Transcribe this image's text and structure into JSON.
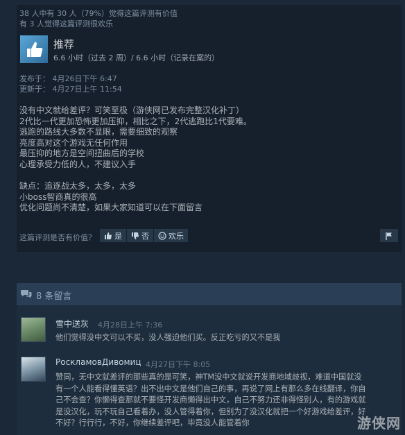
{
  "review": {
    "helpful_line1": "38 人中有 30 人（79%）觉得这篇评测有价值",
    "helpful_line2": "有 3 人觉得这篇评测很欢乐",
    "recommend_label": "推荐",
    "hours": "6.6 小时（过去 2 周）/ 6.6 小时（记录在案的）",
    "posted": "发布于：  4月26日下午 6:47",
    "updated": "更新于：  4月27日上午 11:54",
    "body": [
      "没有中文就给差评？可笑至极（游侠网已发布完整汉化补丁）",
      "2代比一代更加恐怖更加压抑，相比之下，2代逃跑比1代要难。",
      "逃跑的路线大多数不显眼，需要细致的观察",
      "亮度高对这个游戏无任何作用",
      "最压抑的地方是空间扭曲后的学校",
      "心理承受力低的人，不建议入手",
      "",
      "缺点：追逐战太多，太多，太多",
      "小boss智商真的很高",
      "优化问题尚不清楚，如果大家知道可以在下面留言"
    ],
    "helpful_question": "这篇评测是否有价值？",
    "vote_yes": "是",
    "vote_no": "否",
    "vote_funny": "欢乐"
  },
  "comments_header": {
    "label": "8 条留言"
  },
  "comments": [
    {
      "author": "雪中送灰",
      "date": "4月28日上午 7:36",
      "lines": [
        "他们觉得没中文可以不买，没人强迫他们买。反正吃亏的又不是我"
      ]
    },
    {
      "author": "РоскламовДивомиц",
      "date": "4月27日下午 8:05",
      "lines": [
        "赞同，无中文就差评的那些真的是可笑，神TM没中文就说开发商地域歧视，难道中国就没",
        "有一个人能看得懂英语？出不出中文是他们自己的事，再说了网上有那么多在线翻译，你自",
        "己不会查？你懒得查那就不要怪开发商懒得出中文，自己不努力还非得怪别人，有的游戏就",
        "是没汉化，玩不玩自己看着办，没人管得着你，但别为了没汉化就把一个好游戏给差评，好",
        "不好？行行行，不好，你继续差评吧，毕竟没人能管着你"
      ]
    }
  ],
  "watermark": "游侠网",
  "colors": {
    "background": "#1b2838",
    "panel": "#16202d",
    "accent": "#66c0f4"
  }
}
